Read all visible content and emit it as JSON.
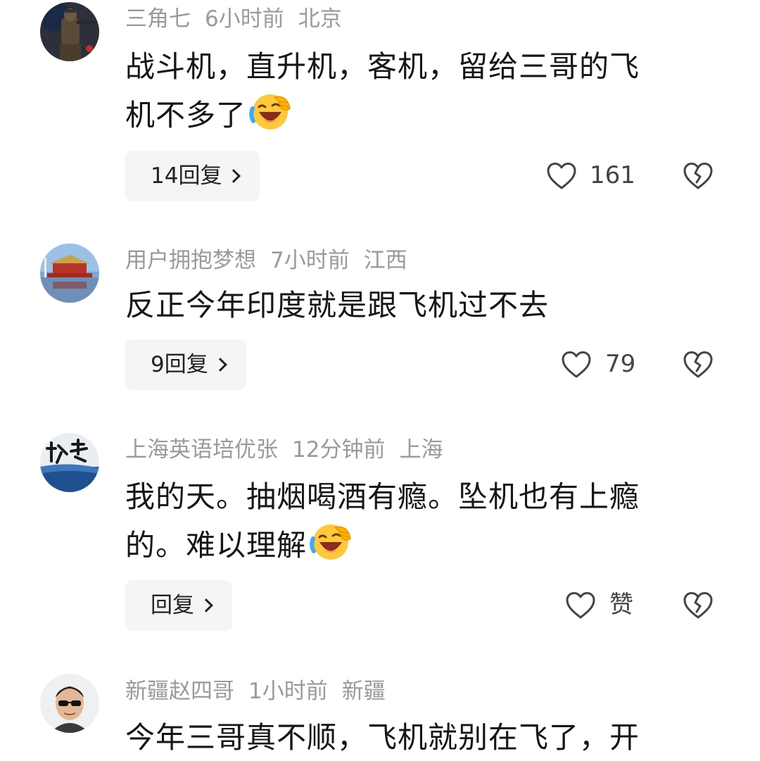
{
  "comments": [
    {
      "username": "三角七",
      "time": "6小时前",
      "location": "北京",
      "text_line1": "战斗机，直升机，客机，留给三哥的飞",
      "text_line2": "机不多了",
      "emoji": "laughing-crying-emoji",
      "reply_label": "14回复",
      "like_count": "161"
    },
    {
      "username": "用户拥抱梦想",
      "time": "7小时前",
      "location": "江西",
      "text_line1": "反正今年印度就是跟飞机过不去",
      "reply_label": "9回复",
      "like_count": "79"
    },
    {
      "username": "上海英语培优张",
      "time": "12分钟前",
      "location": "上海",
      "text_line1": "我的天。抽烟喝酒有瘾。坠机也有上瘾",
      "text_line2": "的。难以理解",
      "emoji": "laughing-crying-emoji",
      "reply_label": "回复",
      "like_count": "赞"
    },
    {
      "username": "新疆赵四哥",
      "time": "1小时前",
      "location": "新疆",
      "text_line1": "今年三哥真不顺，飞机就别在飞了，开"
    }
  ],
  "icons": {
    "like": "heart-outline-icon",
    "dislike": "broken-heart-icon",
    "chevron": "chevron-right-icon"
  },
  "colors": {
    "meta_text": "#9a9a9a",
    "reply_bg": "#f5f5f5",
    "body_text": "#161616"
  }
}
